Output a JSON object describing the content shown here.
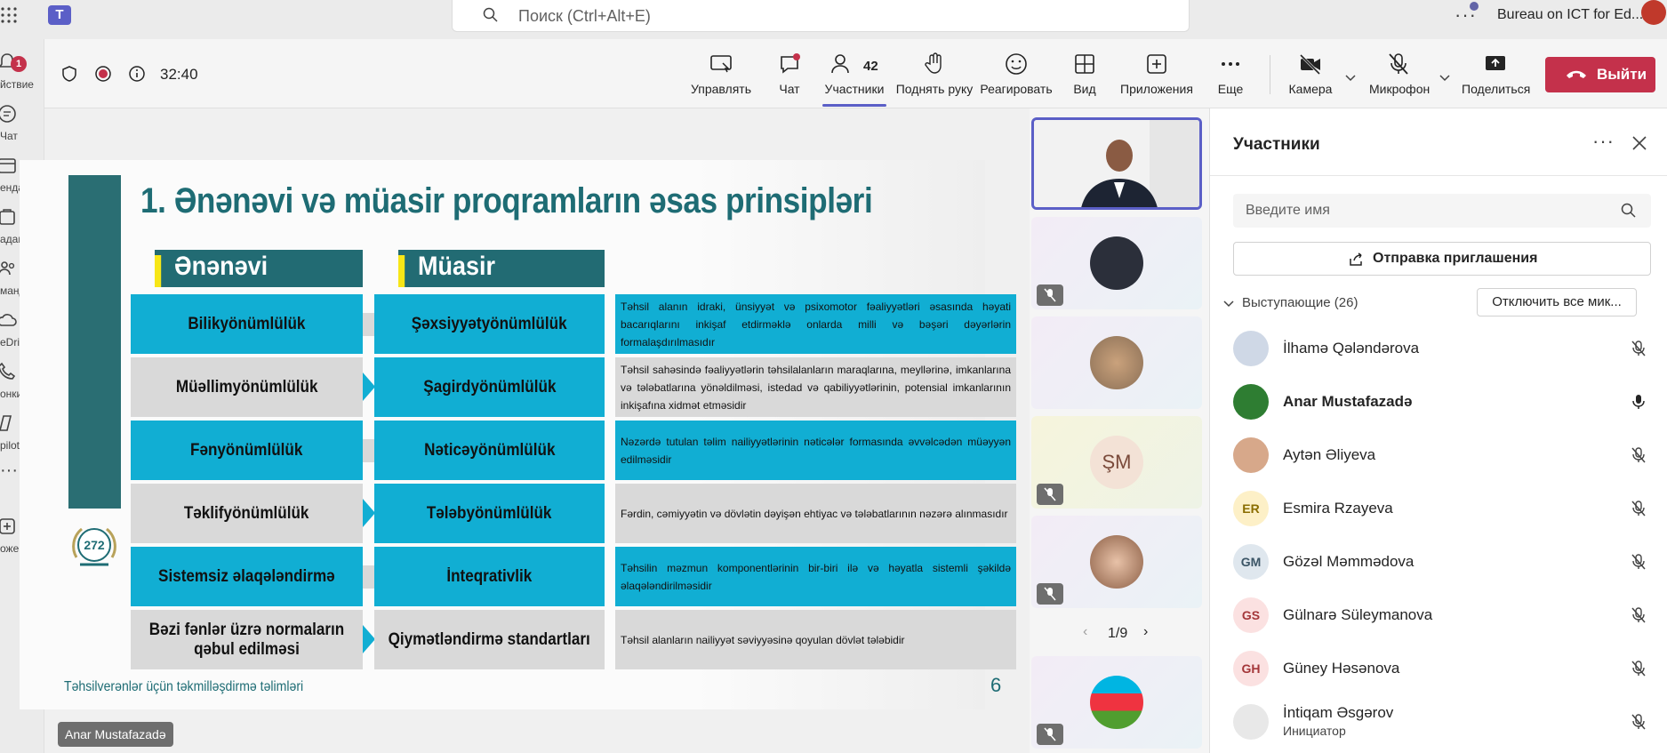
{
  "topbar": {
    "search_placeholder": "Поиск (Ctrl+Alt+E)",
    "org_name": "Bureau on ICT for Ed...",
    "more": "···"
  },
  "rail": {
    "items": [
      {
        "label": "йствие",
        "icon": "bell-icon",
        "badge": "1"
      },
      {
        "label": "Чат",
        "icon": "chat-icon"
      },
      {
        "label": "ендарь",
        "icon": "calendar-icon"
      },
      {
        "label": "адания",
        "icon": "assignments-icon"
      },
      {
        "label": "манды",
        "icon": "teams-icon"
      },
      {
        "label": "eDrive",
        "icon": "onedrive-icon"
      },
      {
        "label": "онки",
        "icon": "calls-icon"
      },
      {
        "label": "pilot",
        "icon": "copilot-icon"
      },
      {
        "label": "···",
        "icon": "more-icon"
      },
      {
        "label": "ожения",
        "icon": "apps-icon"
      }
    ]
  },
  "toolbar": {
    "timer": "32:40",
    "participants_count": "42",
    "buttons": [
      {
        "label": "Управлять",
        "icon": "manage-icon"
      },
      {
        "label": "Чат",
        "icon": "chat-icon"
      },
      {
        "label": "Участники",
        "icon": "people-icon"
      },
      {
        "label": "Поднять руку",
        "icon": "raise-hand-icon"
      },
      {
        "label": "Реагировать",
        "icon": "smile-icon"
      },
      {
        "label": "Вид",
        "icon": "view-grid-icon"
      },
      {
        "label": "Приложения",
        "icon": "add-app-icon"
      },
      {
        "label": "Еще",
        "icon": "more-icon"
      },
      {
        "label": "Камера",
        "icon": "camera-off-icon"
      },
      {
        "label": "Микрофон",
        "icon": "mic-off-icon"
      },
      {
        "label": "Поделиться",
        "icon": "share-icon"
      }
    ],
    "leave_label": "Выйти"
  },
  "slide": {
    "title": "1. Ənənəvi və müasir proqramların əsas prinsipləri",
    "head_left": "Ənənəvi",
    "head_right": "Müasir",
    "rows": [
      {
        "left": "Bilikyönümlülük",
        "right": "Şəxsiyyətyönümlülük",
        "desc": "Təhsil alanın idraki, ünsiyyət və psixomotor fəaliyyətləri əsasında həyati bacarıqlarını inkişaf etdirməklə onlarda milli və bəşəri dəyərlərin formalaşdırılmasıdır"
      },
      {
        "left": "Müəllimyönümlülük",
        "right": "Şagirdyönümlülük",
        "desc": "Təhsil sahəsində fəaliyyətlərin təhsilalanların maraqlarına, meyllərinə, imkanlarına və tələbatlarına yönəldilməsi, istedad və qabiliyyətlərinin, potensial imkanlarının inkişafına xidmət etməsidir"
      },
      {
        "left": "Fənyönümlülük",
        "right": "Nəticəyönümlülük",
        "desc": "Nəzərdə tutulan təlim nailiyyətlərinin nəticələr formasında əvvəlcədən müəyyən edilməsidir"
      },
      {
        "left": "Təklifyönümlülük",
        "right": "Tələbyönümlülük",
        "desc": "Fərdin, cəmiyyətin və dövlətin dəyişən ehtiyac və tələbatlarının nəzərə alınmasıdır"
      },
      {
        "left": "Sistemsiz əlaqələndirmə",
        "right": "İnteqrativlik",
        "desc": "Təhsilin məzmun komponentlərinin bir-biri ilə və həyatla sistemli şəkildə əlaqələndirilməsidir"
      },
      {
        "left": "Bəzi fənlər üzrə normaların qəbul edilməsi",
        "right": "Qiymətləndirmə standartları",
        "desc": "Təhsil alanların nailiyyət səviyyəsinə qoyulan dövlət tələbidir"
      }
    ],
    "footer": "Təhsilverənlər üçün təkmilləşdirmə təlimləri",
    "page_number": "6",
    "seal_number": "272",
    "presenter": "Anar Mustafazadə"
  },
  "tiles": {
    "initials_tile": "ŞM",
    "pager": "1/9"
  },
  "panel": {
    "title": "Участники",
    "search_placeholder": "Введите имя",
    "invite_label": "Отправка приглашения",
    "speakers_label": "Выступающие (26)",
    "mute_all_label": "Отключить все мик...",
    "people": [
      {
        "name": "İlhamə Qələndərova",
        "initials": "",
        "avatar_color": "#cfd8e6",
        "mic": "muted"
      },
      {
        "name": "Anar Mustafazadə",
        "initials": "",
        "avatar_color": "#2e7d32",
        "mic": "on",
        "bold": true
      },
      {
        "name": "Aytən Əliyeva",
        "initials": "",
        "avatar_color": "#d7a88a",
        "mic": "muted"
      },
      {
        "name": "Esmira Rzayeva",
        "initials": "ER",
        "avatar_color": "#fdf0c7",
        "text_color": "#8a6d00",
        "mic": "muted"
      },
      {
        "name": "Gözəl Məmmədova",
        "initials": "GM",
        "avatar_color": "#dfe7ee",
        "text_color": "#3b5566",
        "mic": "muted"
      },
      {
        "name": "Gülnarə Süleymanova",
        "initials": "GS",
        "avatar_color": "#fbe1e1",
        "text_color": "#a4373a",
        "mic": "muted"
      },
      {
        "name": "Güney Həsənova",
        "initials": "GH",
        "avatar_color": "#fbe1e1",
        "text_color": "#a4373a",
        "mic": "muted"
      },
      {
        "name": "İntiqam Əsgərov",
        "sub": "Инициатор",
        "initials": "",
        "avatar_color": "#e8e8e8",
        "mic": "muted"
      }
    ]
  }
}
